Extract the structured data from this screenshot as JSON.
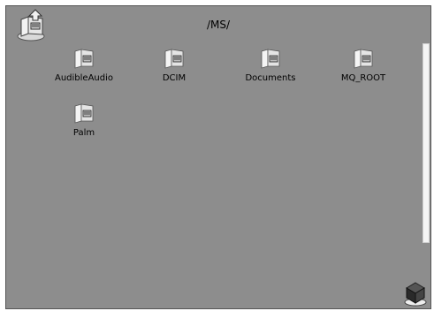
{
  "window": {
    "path": "/MS/"
  },
  "folders": [
    {
      "label": "AudibleAudio"
    },
    {
      "label": "DCIM"
    },
    {
      "label": "Documents"
    },
    {
      "label": "MQ_ROOT"
    },
    {
      "label": "Palm"
    }
  ],
  "icons": {
    "up": "folder-up-icon",
    "folder": "folder-icon",
    "corner": "cube-icon"
  }
}
